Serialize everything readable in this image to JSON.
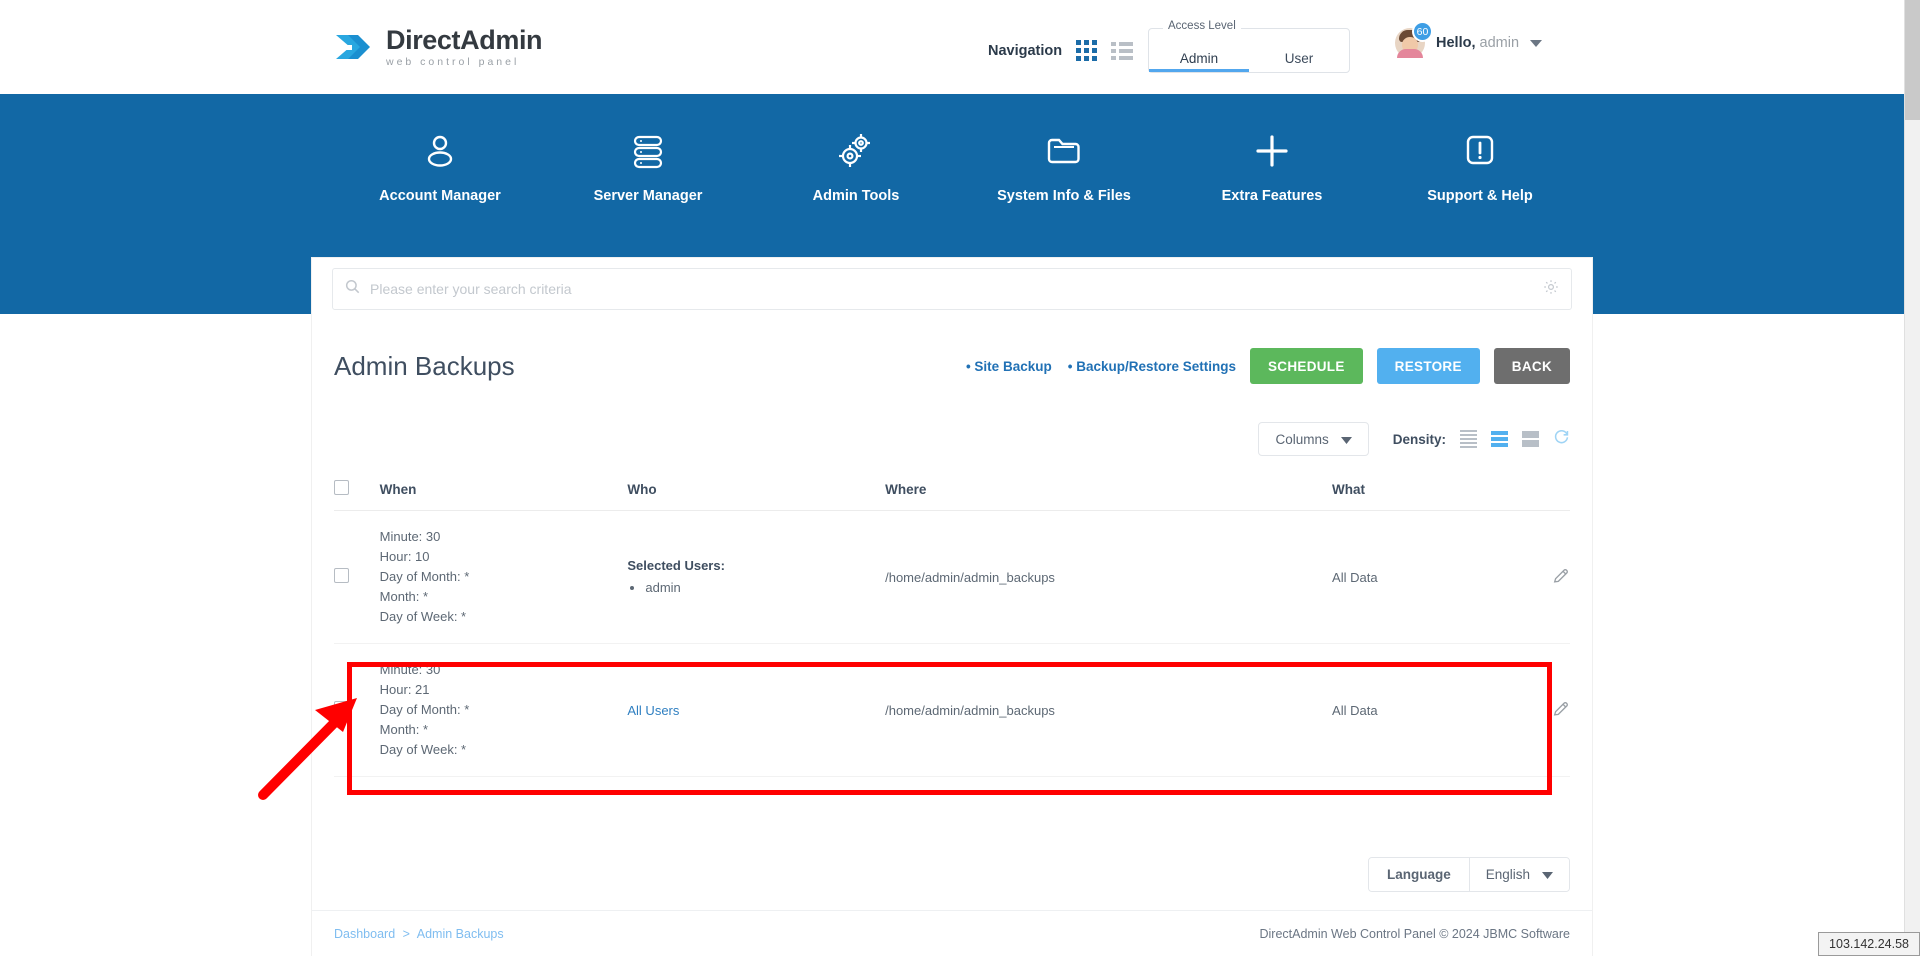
{
  "header": {
    "logo": {
      "title_bold": "Direct",
      "title_rest": "Admin",
      "subtitle": "web control panel",
      "icon": "directadmin-chevrons-logo"
    },
    "navigation_label": "Navigation",
    "grid_view_icon": "grid-view-icon",
    "list_view_icon": "list-view-icon",
    "access_level": {
      "legend": "Access Level",
      "tabs": [
        "Admin",
        "User"
      ],
      "active": "Admin"
    },
    "user": {
      "greeting": "Hello,",
      "name": "admin",
      "badge": "60",
      "avatar_icon": "user-avatar",
      "caret_icon": "chevron-down-icon"
    }
  },
  "main_nav": [
    {
      "label": "Account Manager",
      "icon": "person-icon"
    },
    {
      "label": "Server Manager",
      "icon": "server-stack-icon"
    },
    {
      "label": "Admin Tools",
      "icon": "gears-icon"
    },
    {
      "label": "System Info & Files",
      "icon": "folder-icon"
    },
    {
      "label": "Extra Features",
      "icon": "plus-icon"
    },
    {
      "label": "Support & Help",
      "icon": "exclamation-box-icon"
    }
  ],
  "search": {
    "placeholder": "Please enter your search criteria",
    "value": "",
    "search_icon": "search-icon",
    "settings_icon": "gear-icon"
  },
  "page": {
    "title": "Admin Backups",
    "links": [
      "• Site Backup",
      "• Backup/Restore Settings"
    ],
    "buttons": [
      {
        "label": "SCHEDULE",
        "color": "#5cb85c"
      },
      {
        "label": "RESTORE",
        "color": "#52b0ef"
      },
      {
        "label": "BACK",
        "color": "#6e6e6e"
      }
    ]
  },
  "toolbar": {
    "columns_label": "Columns",
    "columns_caret_icon": "caret-down-icon",
    "density_label": "Density:",
    "density_options": [
      "compact",
      "standard",
      "comfortable"
    ],
    "density_active": "standard",
    "refresh_icon": "refresh-icon"
  },
  "table": {
    "headers": [
      "When",
      "Who",
      "Where",
      "What"
    ],
    "select_all_checkbox": "",
    "rows": [
      {
        "when": [
          "Minute: 30",
          "Hour: 10",
          "Day of Month: *",
          "Month: *",
          "Day of Week: *"
        ],
        "who_title": "Selected Users:",
        "who_items": [
          "admin"
        ],
        "who_link": "",
        "where": "/home/admin/admin_backups",
        "what": "All Data",
        "edit_icon": "pencil-icon",
        "highlighted": false
      },
      {
        "when": [
          "Minute: 30",
          "Hour: 21",
          "Day of Month: *",
          "Month: *",
          "Day of Week: *"
        ],
        "who_title": "",
        "who_items": [],
        "who_link": "All Users",
        "where": "/home/admin/admin_backups",
        "what": "All Data",
        "edit_icon": "pencil-icon",
        "highlighted": true
      }
    ]
  },
  "footer": {
    "language_label": "Language",
    "language_value": "English",
    "language_caret_icon": "caret-down-icon",
    "breadcrumb": {
      "root": "Dashboard",
      "separator": ">",
      "current": "Admin Backups"
    },
    "copyright": "DirectAdmin Web Control Panel © 2024 JBMC Software"
  },
  "status_bar": {
    "text": "103.142.24.58"
  },
  "colors": {
    "brand_blue": "#1268a5",
    "accent_blue": "#52b0ef",
    "green": "#5cb85c",
    "gray": "#6e6e6e",
    "highlight_red": "#ff0000"
  }
}
